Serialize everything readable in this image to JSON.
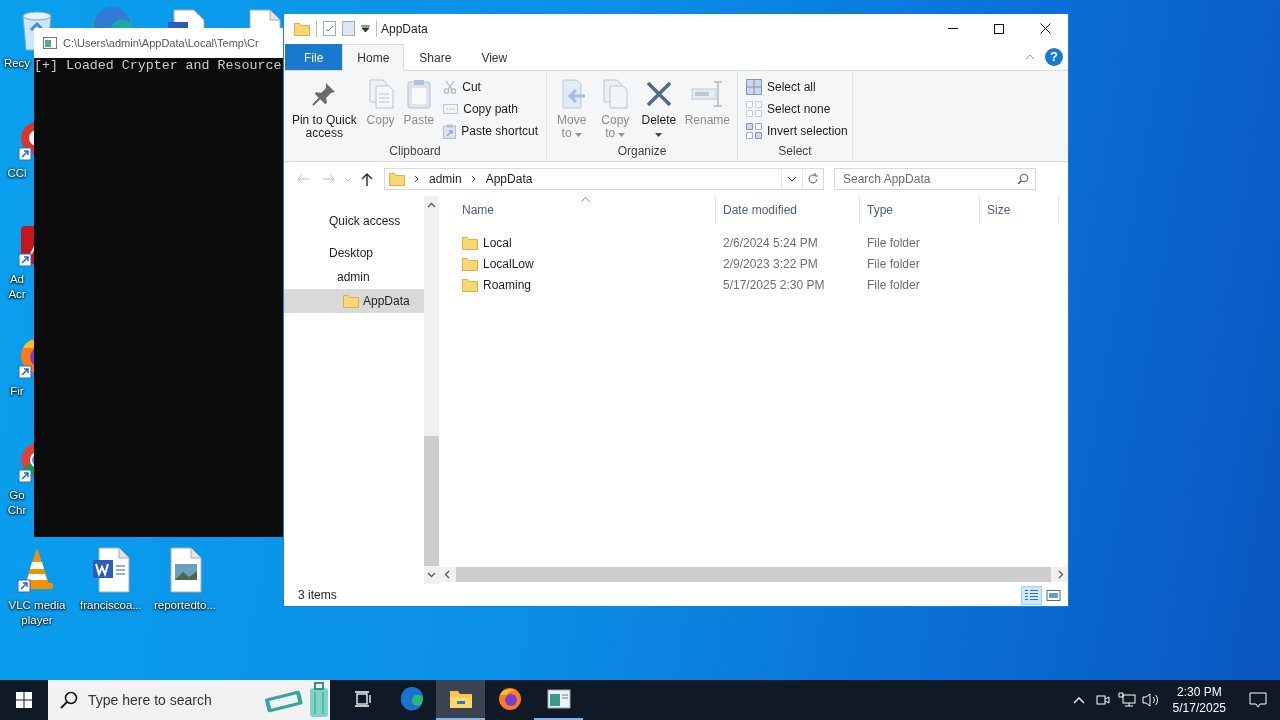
{
  "desktop": {
    "icons": [
      {
        "label": "Recy"
      },
      {
        "label": "CCl"
      },
      {
        "label": "Ad Acr"
      },
      {
        "label": "Fir"
      },
      {
        "label": "Go Chr"
      },
      {
        "label": "VLC media player"
      },
      {
        "label": "franciscoa..."
      },
      {
        "label": "reportedto..."
      }
    ]
  },
  "console": {
    "title": "C:\\Users\\admin\\AppData\\Local\\Temp\\Cr",
    "lines": [
      "[+] Loaded Crypter and Resource"
    ]
  },
  "explorer": {
    "title": "AppData",
    "tabs": [
      {
        "label": "File",
        "kind": "file",
        "selected": false
      },
      {
        "label": "Home",
        "kind": "tab",
        "selected": true
      },
      {
        "label": "Share",
        "kind": "tab",
        "selected": false
      },
      {
        "label": "View",
        "kind": "tab",
        "selected": false
      }
    ],
    "help": "?",
    "ribbon": {
      "groups": [
        {
          "label": "Clipboard",
          "items": [
            {
              "kind": "large",
              "label": "Pin to Quick access",
              "disabled": false
            },
            {
              "kind": "large",
              "label": "Copy",
              "disabled": true
            },
            {
              "kind": "large",
              "label": "Paste",
              "disabled": true
            },
            {
              "kind": "small",
              "label": "Cut",
              "disabled": true
            },
            {
              "kind": "small",
              "label": "Copy path",
              "disabled": true
            },
            {
              "kind": "small",
              "label": "Paste shortcut",
              "disabled": true
            }
          ]
        },
        {
          "label": "Organize",
          "items": [
            {
              "kind": "large",
              "label": "Move to",
              "disabled": true,
              "has_menu": true
            },
            {
              "kind": "large",
              "label": "Copy to",
              "disabled": true,
              "has_menu": true
            },
            {
              "kind": "large",
              "label": "Delete",
              "disabled": false,
              "has_menu": true
            },
            {
              "kind": "large",
              "label": "Rename",
              "disabled": true
            }
          ]
        },
        {
          "label": "Select",
          "items": [
            {
              "kind": "small",
              "label": "Select all",
              "disabled": false
            },
            {
              "kind": "small",
              "label": "Select none",
              "disabled": true
            },
            {
              "kind": "small",
              "label": "Invert selection",
              "disabled": false
            }
          ]
        }
      ]
    },
    "address": {
      "path": [
        "admin",
        "AppData"
      ]
    },
    "search": {
      "placeholder": "Search AppData"
    },
    "nav_pane": [
      {
        "label": "Quick access",
        "kind": "plain",
        "selected": false
      },
      {
        "label": "Desktop",
        "kind": "plain",
        "selected": false,
        "children": [
          {
            "label": "admin",
            "kind": "plain",
            "selected": false,
            "children": [
              {
                "label": "AppData",
                "kind": "folder",
                "selected": true
              }
            ]
          }
        ]
      }
    ],
    "columns": [
      {
        "label": "Name",
        "sorted": true
      },
      {
        "label": "Date modified",
        "sorted": false
      },
      {
        "label": "Type",
        "sorted": false
      },
      {
        "label": "Size",
        "sorted": false
      }
    ],
    "files": [
      {
        "name": "Local",
        "date_modified": "2/6/2024 5:24 PM",
        "type": "File folder",
        "selected": false
      },
      {
        "name": "LocalLow",
        "date_modified": "2/9/2023 3:22 PM",
        "type": "File folder",
        "selected": false
      },
      {
        "name": "Roaming",
        "date_modified": "5/17/2025 2:30 PM",
        "type": "File folder",
        "selected": false
      }
    ],
    "status": "3 items",
    "views": [
      {
        "selected": true
      },
      {
        "selected": false
      }
    ]
  },
  "taskbar": {
    "search_placeholder": "Type here to search",
    "apps": [
      {
        "active": false,
        "running": false
      },
      {
        "active": false,
        "running": false
      },
      {
        "active": true,
        "running": true
      },
      {
        "active": false,
        "running": false
      },
      {
        "active": false,
        "running": true
      }
    ],
    "time": "2:30 PM",
    "date": "5/17/2025"
  }
}
